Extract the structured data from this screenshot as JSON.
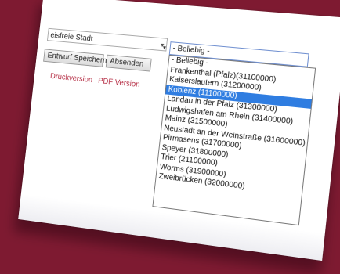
{
  "form": {
    "district_value": "eisfreie Stadt",
    "city_value": "- Beliebig -"
  },
  "buttons": {
    "draft_label": "Entwurf Speichern",
    "send_label": "Absenden"
  },
  "links": {
    "print_label": "Druckversion",
    "pdf_label": "PDF Version"
  },
  "dropdown": {
    "selected_index": 3,
    "options": [
      "- Beliebig -",
      "Frankenthal (Pfalz)(31100000)",
      "Kaiserslautern (31200000)",
      "Koblenz (11100000)",
      "Landau in der Pfalz (31300000)",
      "Ludwigshafen am Rhein (31400000)",
      "Mainz (31500000)",
      "Neustadt an der Weinstraße (31600000)",
      "Pirmasens (31700000)",
      "Speyer (31800000)",
      "Trier (21100000)",
      "Worms (31900000)",
      "Zweibrücken (32000000)"
    ]
  },
  "icons": {
    "dropdown_arrow": "▾"
  },
  "colors": {
    "background": "#7e1a31",
    "selection": "#2f7de1",
    "link": "#b3263e"
  }
}
